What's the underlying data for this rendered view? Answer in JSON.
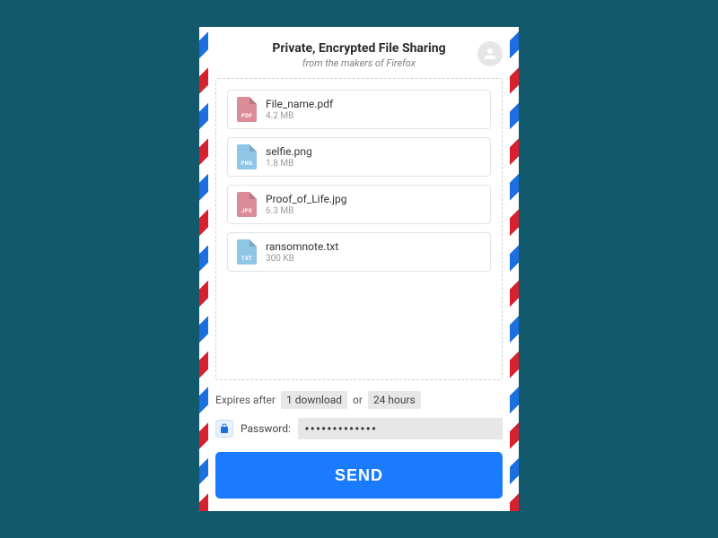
{
  "header": {
    "title": "Private, Encrypted File Sharing",
    "subtitle": "from the makers of Firefox"
  },
  "files": [
    {
      "name": "File_name.pdf",
      "size": "4.2 MB",
      "ext": "PDF",
      "color": "#dd8b99"
    },
    {
      "name": "selfie.png",
      "size": "1.8 MB",
      "ext": "PNG",
      "color": "#8fc6e6"
    },
    {
      "name": "Proof_of_Life.jpg",
      "size": "6.3 MB",
      "ext": "JPG",
      "color": "#dd8b99"
    },
    {
      "name": "ransomnote.txt",
      "size": "300 KB",
      "ext": "TXT",
      "color": "#8fc6e6"
    }
  ],
  "expires": {
    "label": "Expires after",
    "downloads": "1 download",
    "or": "or",
    "time": "24 hours"
  },
  "password": {
    "label": "Password:",
    "value": "•••••••••••••"
  },
  "send": "SEND"
}
